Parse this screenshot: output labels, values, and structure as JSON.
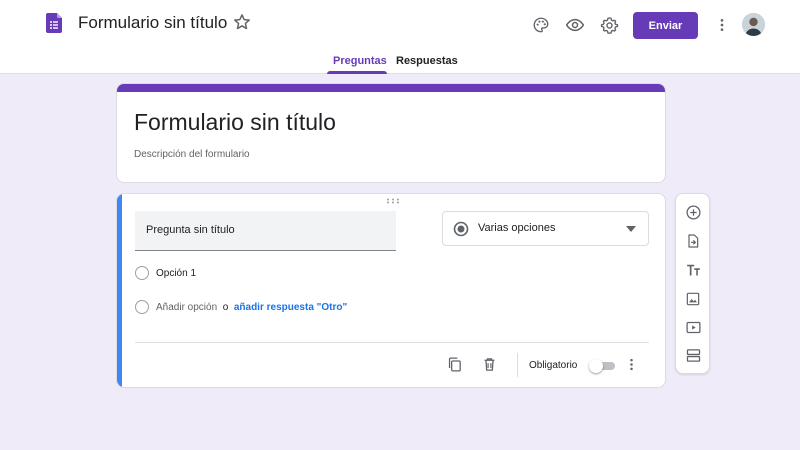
{
  "header": {
    "app_title": "Formulario sin título",
    "send_label": "Enviar"
  },
  "tabs": [
    {
      "label": "Preguntas",
      "active": true
    },
    {
      "label": "Respuestas",
      "active": false
    }
  ],
  "form": {
    "title": "Formulario sin título",
    "description_placeholder": "Descripción del formulario"
  },
  "question": {
    "title_placeholder": "Pregunta sin título",
    "type_label": "Varias opciones",
    "options": [
      {
        "label": "Opción 1"
      }
    ],
    "add_option_label": "Añadir opción",
    "or_label": "o",
    "add_other_label": "añadir respuesta \"Otro\"",
    "required_label": "Obligatorio",
    "required": false
  },
  "icons": {
    "header": [
      "forms-logo-icon",
      "star-icon",
      "palette-icon",
      "preview-eye-icon",
      "settings-gear-icon",
      "more-vert-icon"
    ],
    "question_footer": [
      "duplicate-icon",
      "delete-icon",
      "more-vert-icon"
    ],
    "side_toolbar": [
      "add-question-icon",
      "import-questions-icon",
      "add-title-icon",
      "add-image-icon",
      "add-video-icon",
      "add-section-icon"
    ]
  },
  "colors": {
    "accent": "#673ab7",
    "background": "#f0ebf8",
    "active_question": "#4285f4",
    "link": "#1a73e8"
  }
}
